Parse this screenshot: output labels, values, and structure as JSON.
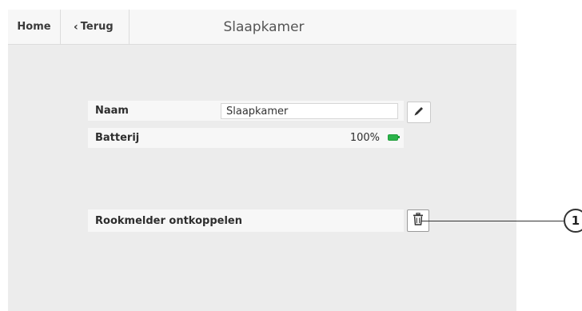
{
  "nav": {
    "home_label": "Home",
    "back_label": "Terug",
    "title": "Slaapkamer"
  },
  "detail": {
    "name_label": "Naam",
    "name_value": "Slaapkamer",
    "battery_label": "Batterij",
    "battery_value": "100%",
    "battery_fraction": 1.0,
    "disconnect_label": "Rookmelder ontkoppelen"
  },
  "icons": {
    "back": "chevron-left-icon",
    "edit": "pencil-icon",
    "battery": "battery-full-icon",
    "delete": "trash-icon"
  },
  "callout": {
    "number": "1"
  },
  "colors": {
    "battery_green": "#2bb34a",
    "background": "#ececec",
    "row_background": "#f7f7f7"
  }
}
